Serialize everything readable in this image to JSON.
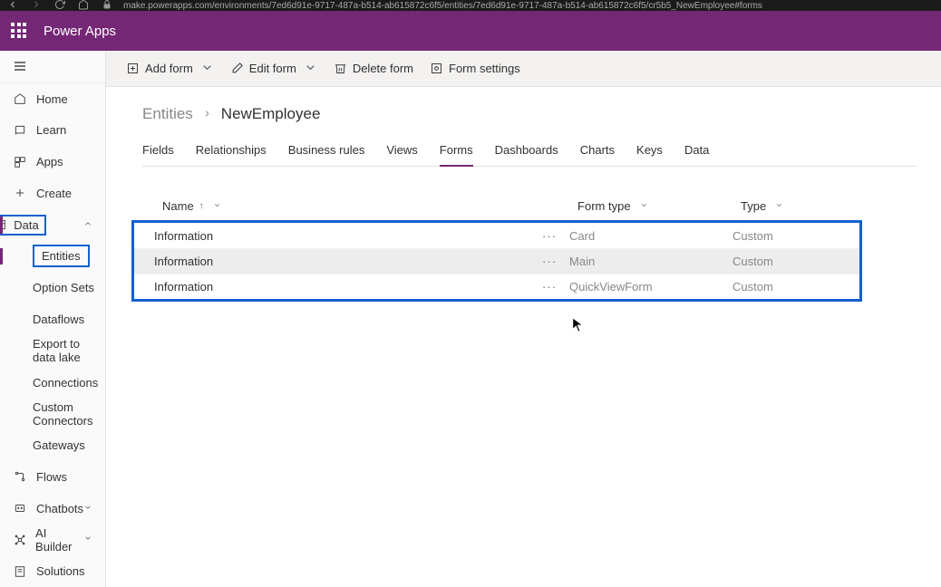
{
  "browser": {
    "url": "make.powerapps.com/environments/7ed6d91e-9717-487a-b514-ab615872c6f5/entities/7ed6d91e-9717-487a-b514-ab615872c6f5/cr5b5_NewEmployee#forms"
  },
  "header": {
    "app_title": "Power Apps"
  },
  "sidebar": {
    "items": [
      {
        "label": "Home"
      },
      {
        "label": "Learn"
      },
      {
        "label": "Apps"
      },
      {
        "label": "Create"
      },
      {
        "label": "Data"
      },
      {
        "label": "Flows"
      },
      {
        "label": "Chatbots"
      },
      {
        "label": "AI Builder"
      },
      {
        "label": "Solutions"
      }
    ],
    "sub_items": [
      {
        "label": "Entities"
      },
      {
        "label": "Option Sets"
      },
      {
        "label": "Dataflows"
      },
      {
        "label": "Export to data lake"
      },
      {
        "label": "Connections"
      },
      {
        "label": "Custom Connectors"
      },
      {
        "label": "Gateways"
      }
    ]
  },
  "cmdbar": {
    "add_form": "Add form",
    "edit_form": "Edit form",
    "delete_form": "Delete form",
    "form_settings": "Form settings"
  },
  "breadcrumb": {
    "root": "Entities",
    "current": "NewEmployee"
  },
  "tabs": [
    "Fields",
    "Relationships",
    "Business rules",
    "Views",
    "Forms",
    "Dashboards",
    "Charts",
    "Keys",
    "Data"
  ],
  "active_tab": "Forms",
  "table": {
    "columns": {
      "name": "Name",
      "form_type": "Form type",
      "type": "Type"
    },
    "rows": [
      {
        "name": "Information",
        "form_type": "Card",
        "type": "Custom"
      },
      {
        "name": "Information",
        "form_type": "Main",
        "type": "Custom"
      },
      {
        "name": "Information",
        "form_type": "QuickViewForm",
        "type": "Custom"
      }
    ]
  }
}
